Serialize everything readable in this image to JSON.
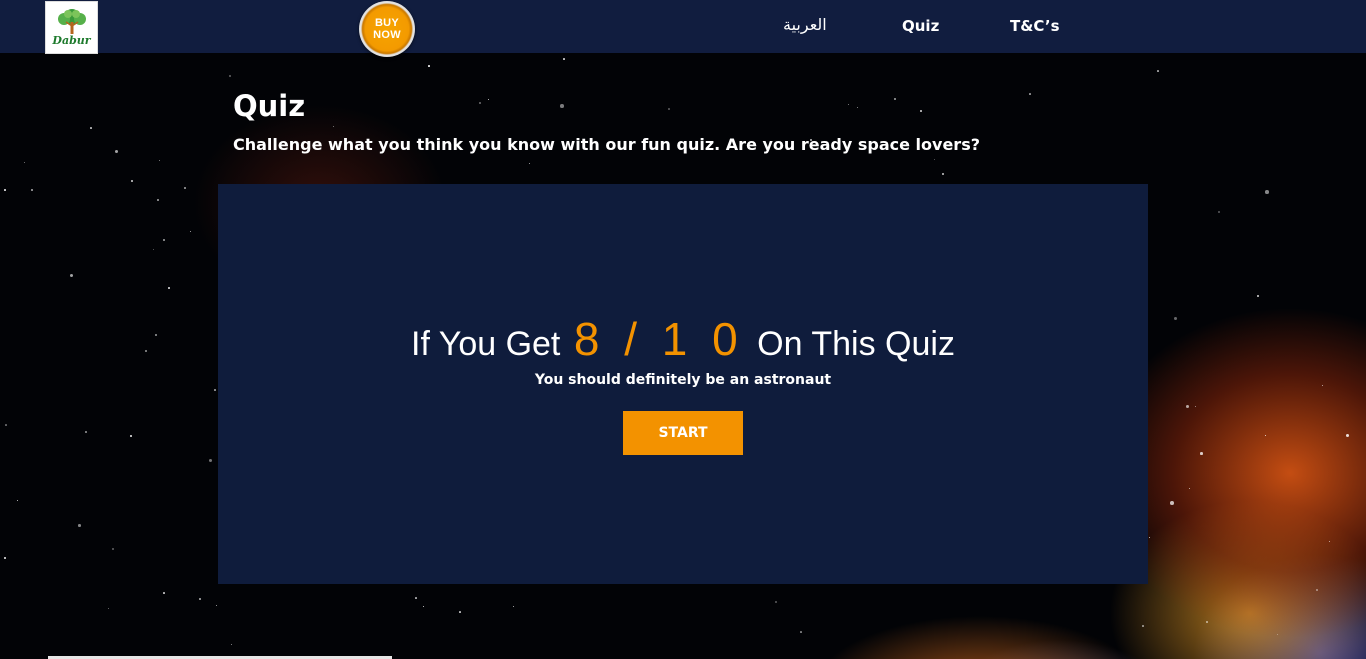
{
  "header": {
    "logo_text": "Dabur",
    "buy_now": {
      "line1": "BUY",
      "line2": "NOW"
    },
    "nav": [
      {
        "label": "العربية"
      },
      {
        "label": "Quiz"
      },
      {
        "label": "T&C’s"
      }
    ]
  },
  "main": {
    "title": "Quiz",
    "subtitle": "Challenge what you think you know with our fun quiz. Are you ready space lovers?",
    "panel": {
      "headline_prefix": "If You Get",
      "score": "8 / 1 0",
      "headline_suffix": "On This Quiz",
      "tagline": "You should definitely be an astronaut",
      "start_label": "START"
    }
  },
  "colors": {
    "navbar": "#111d3f",
    "panel": "#0f1c3c",
    "accent": "#f39200"
  }
}
